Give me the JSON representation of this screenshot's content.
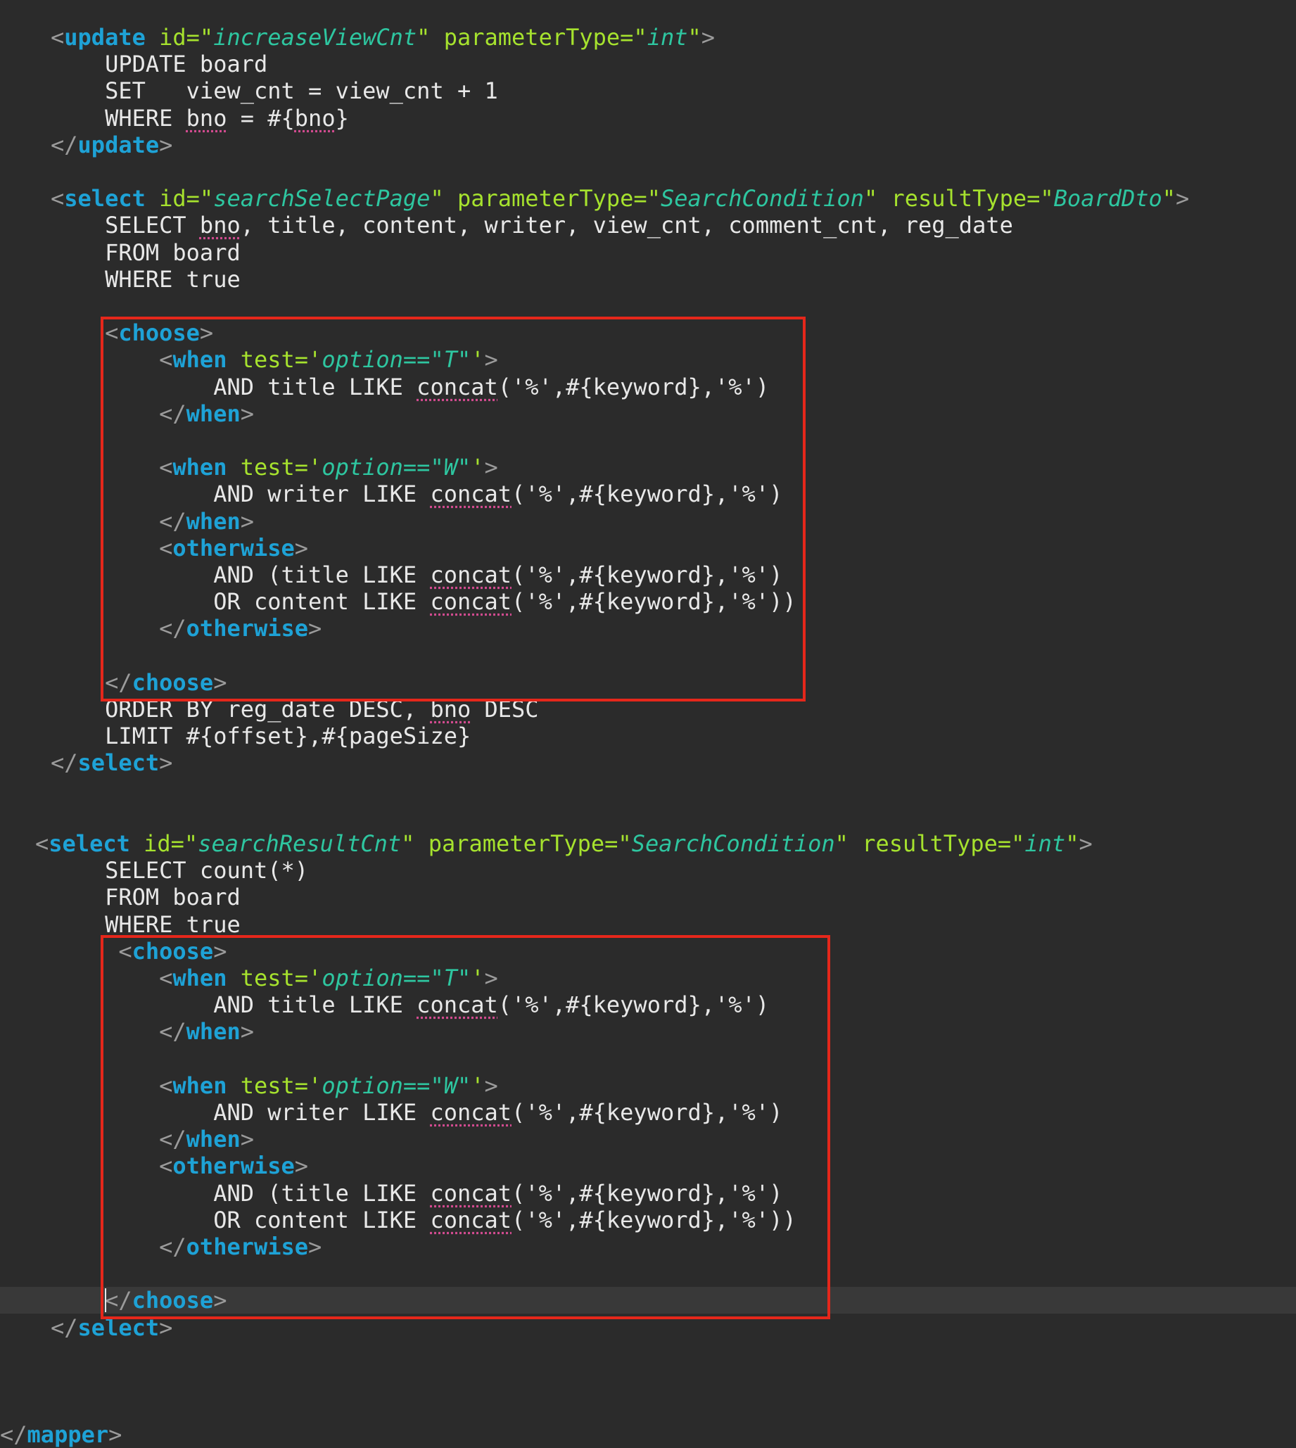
{
  "editor": {
    "lines": [
      [
        {
          "c": "punct",
          "t": "<"
        },
        {
          "c": "tag",
          "t": "update"
        },
        {
          "c": "sql",
          "t": " "
        },
        {
          "c": "attr",
          "t": "id="
        },
        {
          "c": "attr",
          "t": "\""
        },
        {
          "c": "str",
          "t": "increaseViewCnt"
        },
        {
          "c": "attr",
          "t": "\""
        },
        {
          "c": "sql",
          "t": " "
        },
        {
          "c": "attr",
          "t": "parameterType=\""
        },
        {
          "c": "str",
          "t": "int"
        },
        {
          "c": "attr",
          "t": "\""
        },
        {
          "c": "punct",
          "t": ">"
        }
      ],
      [
        {
          "c": "sql",
          "t": "    UPDATE board"
        }
      ],
      [
        {
          "c": "sql",
          "t": "    SET   view_cnt = view_cnt + 1"
        }
      ],
      [
        {
          "c": "sql",
          "t": "    WHERE "
        },
        {
          "c": "warn",
          "t": "bno"
        },
        {
          "c": "sql",
          "t": " = #{"
        },
        {
          "c": "warn",
          "t": "bno"
        },
        {
          "c": "sql",
          "t": "}"
        }
      ],
      [
        {
          "c": "punct",
          "t": "</"
        },
        {
          "c": "tag",
          "t": "update"
        },
        {
          "c": "punct",
          "t": ">"
        }
      ],
      [],
      [
        {
          "c": "punct",
          "t": "<"
        },
        {
          "c": "tag",
          "t": "select"
        },
        {
          "c": "sql",
          "t": " "
        },
        {
          "c": "attr",
          "t": "id=\""
        },
        {
          "c": "str",
          "t": "searchSelectPage"
        },
        {
          "c": "attr",
          "t": "\""
        },
        {
          "c": "sql",
          "t": " "
        },
        {
          "c": "attr",
          "t": "parameterType=\""
        },
        {
          "c": "str",
          "t": "SearchCondition"
        },
        {
          "c": "attr",
          "t": "\""
        },
        {
          "c": "sql",
          "t": " "
        },
        {
          "c": "attr",
          "t": "resultType=\""
        },
        {
          "c": "str",
          "t": "BoardDto"
        },
        {
          "c": "attr",
          "t": "\""
        },
        {
          "c": "punct",
          "t": ">"
        }
      ],
      [
        {
          "c": "sql",
          "t": "    SELECT "
        },
        {
          "c": "warn",
          "t": "bno"
        },
        {
          "c": "sql",
          "t": ", title, content, writer, view_cnt, comment_cnt, reg_date"
        }
      ],
      [
        {
          "c": "sql",
          "t": "    FROM board"
        }
      ],
      [
        {
          "c": "sql",
          "t": "    WHERE true"
        }
      ],
      [],
      [
        {
          "c": "sql",
          "t": "    "
        },
        {
          "c": "punct",
          "t": "<"
        },
        {
          "c": "tag",
          "t": "choose"
        },
        {
          "c": "punct",
          "t": ">"
        }
      ],
      [
        {
          "c": "sql",
          "t": "        "
        },
        {
          "c": "punct",
          "t": "<"
        },
        {
          "c": "tag",
          "t": "when"
        },
        {
          "c": "sql",
          "t": " "
        },
        {
          "c": "attr",
          "t": "test='"
        },
        {
          "c": "str",
          "t": "option==\"T\""
        },
        {
          "c": "attr",
          "t": "'"
        },
        {
          "c": "punct",
          "t": ">"
        }
      ],
      [
        {
          "c": "sql",
          "t": "            AND title LIKE "
        },
        {
          "c": "warn",
          "t": "concat"
        },
        {
          "c": "sql",
          "t": "('%',#{keyword},'%')"
        }
      ],
      [
        {
          "c": "sql",
          "t": "        "
        },
        {
          "c": "punct",
          "t": "</"
        },
        {
          "c": "tag",
          "t": "when"
        },
        {
          "c": "punct",
          "t": ">"
        }
      ],
      [],
      [
        {
          "c": "sql",
          "t": "        "
        },
        {
          "c": "punct",
          "t": "<"
        },
        {
          "c": "tag",
          "t": "when"
        },
        {
          "c": "sql",
          "t": " "
        },
        {
          "c": "attr",
          "t": "test='"
        },
        {
          "c": "str",
          "t": "option==\"W\""
        },
        {
          "c": "attr",
          "t": "'"
        },
        {
          "c": "punct",
          "t": ">"
        }
      ],
      [
        {
          "c": "sql",
          "t": "            AND writer LIKE "
        },
        {
          "c": "warn",
          "t": "concat"
        },
        {
          "c": "sql",
          "t": "('%',#{keyword},'%')"
        }
      ],
      [
        {
          "c": "sql",
          "t": "        "
        },
        {
          "c": "punct",
          "t": "</"
        },
        {
          "c": "tag",
          "t": "when"
        },
        {
          "c": "punct",
          "t": ">"
        }
      ],
      [
        {
          "c": "sql",
          "t": "        "
        },
        {
          "c": "punct",
          "t": "<"
        },
        {
          "c": "tag",
          "t": "otherwise"
        },
        {
          "c": "punct",
          "t": ">"
        }
      ],
      [
        {
          "c": "sql",
          "t": "            AND (title LIKE "
        },
        {
          "c": "warn",
          "t": "concat"
        },
        {
          "c": "sql",
          "t": "('%',#{keyword},'%')"
        }
      ],
      [
        {
          "c": "sql",
          "t": "            OR content LIKE "
        },
        {
          "c": "warn",
          "t": "concat"
        },
        {
          "c": "sql",
          "t": "('%',#{keyword},'%'))"
        }
      ],
      [
        {
          "c": "sql",
          "t": "        "
        },
        {
          "c": "punct",
          "t": "</"
        },
        {
          "c": "tag",
          "t": "otherwise"
        },
        {
          "c": "punct",
          "t": ">"
        }
      ],
      [],
      [
        {
          "c": "sql",
          "t": "    "
        },
        {
          "c": "punct",
          "t": "</"
        },
        {
          "c": "tag",
          "t": "choose"
        },
        {
          "c": "punct",
          "t": ">"
        }
      ],
      [
        {
          "c": "sql",
          "t": "    ORDER BY reg_date DESC, "
        },
        {
          "c": "warn",
          "t": "bno"
        },
        {
          "c": "sql",
          "t": " DESC"
        }
      ],
      [
        {
          "c": "sql",
          "t": "    LIMIT #{offset},#{pageSize}"
        }
      ],
      [
        {
          "c": "punct",
          "t": "</"
        },
        {
          "c": "tag",
          "t": "select"
        },
        {
          "c": "punct",
          "t": ">"
        }
      ],
      [],
      [],
      [
        {
          "c": "punct",
          "t": "<"
        },
        {
          "c": "tag",
          "t": "select"
        },
        {
          "c": "sql",
          "t": " "
        },
        {
          "c": "attr",
          "t": "id=\""
        },
        {
          "c": "str",
          "t": "searchResultCnt"
        },
        {
          "c": "attr",
          "t": "\""
        },
        {
          "c": "sql",
          "t": " "
        },
        {
          "c": "attr",
          "t": "parameterType=\""
        },
        {
          "c": "str",
          "t": "SearchCondition"
        },
        {
          "c": "attr",
          "t": "\""
        },
        {
          "c": "sql",
          "t": " "
        },
        {
          "c": "attr",
          "t": "resultType=\""
        },
        {
          "c": "str",
          "t": "int"
        },
        {
          "c": "attr",
          "t": "\""
        },
        {
          "c": "punct",
          "t": ">"
        }
      ],
      [
        {
          "c": "sql",
          "t": "    SELECT count(*)"
        }
      ],
      [
        {
          "c": "sql",
          "t": "    FROM board"
        }
      ],
      [
        {
          "c": "sql",
          "t": "    WHERE true"
        }
      ],
      [
        {
          "c": "sql",
          "t": "     "
        },
        {
          "c": "punct",
          "t": "<"
        },
        {
          "c": "tag",
          "t": "choose"
        },
        {
          "c": "punct",
          "t": ">"
        }
      ],
      [
        {
          "c": "sql",
          "t": "        "
        },
        {
          "c": "punct",
          "t": "<"
        },
        {
          "c": "tag",
          "t": "when"
        },
        {
          "c": "sql",
          "t": " "
        },
        {
          "c": "attr",
          "t": "test='"
        },
        {
          "c": "str",
          "t": "option==\"T\""
        },
        {
          "c": "attr",
          "t": "'"
        },
        {
          "c": "punct",
          "t": ">"
        }
      ],
      [
        {
          "c": "sql",
          "t": "            AND title LIKE "
        },
        {
          "c": "warn",
          "t": "concat"
        },
        {
          "c": "sql",
          "t": "('%',#{keyword},'%')"
        }
      ],
      [
        {
          "c": "sql",
          "t": "        "
        },
        {
          "c": "punct",
          "t": "</"
        },
        {
          "c": "tag",
          "t": "when"
        },
        {
          "c": "punct",
          "t": ">"
        }
      ],
      [],
      [
        {
          "c": "sql",
          "t": "        "
        },
        {
          "c": "punct",
          "t": "<"
        },
        {
          "c": "tag",
          "t": "when"
        },
        {
          "c": "sql",
          "t": " "
        },
        {
          "c": "attr",
          "t": "test='"
        },
        {
          "c": "str",
          "t": "option==\"W\""
        },
        {
          "c": "attr",
          "t": "'"
        },
        {
          "c": "punct",
          "t": ">"
        }
      ],
      [
        {
          "c": "sql",
          "t": "            AND writer LIKE "
        },
        {
          "c": "warn",
          "t": "concat"
        },
        {
          "c": "sql",
          "t": "('%',#{keyword},'%')"
        }
      ],
      [
        {
          "c": "sql",
          "t": "        "
        },
        {
          "c": "punct",
          "t": "</"
        },
        {
          "c": "tag",
          "t": "when"
        },
        {
          "c": "punct",
          "t": ">"
        }
      ],
      [
        {
          "c": "sql",
          "t": "        "
        },
        {
          "c": "punct",
          "t": "<"
        },
        {
          "c": "tag",
          "t": "otherwise"
        },
        {
          "c": "punct",
          "t": ">"
        }
      ],
      [
        {
          "c": "sql",
          "t": "            AND (title LIKE "
        },
        {
          "c": "warn",
          "t": "concat"
        },
        {
          "c": "sql",
          "t": "('%',#{keyword},'%')"
        }
      ],
      [
        {
          "c": "sql",
          "t": "            OR content LIKE "
        },
        {
          "c": "warn",
          "t": "concat"
        },
        {
          "c": "sql",
          "t": "('%',#{keyword},'%'))"
        }
      ],
      [
        {
          "c": "sql",
          "t": "        "
        },
        {
          "c": "punct",
          "t": "</"
        },
        {
          "c": "tag",
          "t": "otherwise"
        },
        {
          "c": "punct",
          "t": ">"
        }
      ],
      [],
      [
        {
          "c": "sql",
          "t": "    "
        },
        {
          "c": "punct",
          "t": "</"
        },
        {
          "c": "tag",
          "t": "choose"
        },
        {
          "c": "punct",
          "t": ">"
        }
      ],
      [
        {
          "c": "punct",
          "t": "</"
        },
        {
          "c": "tag",
          "t": "select"
        },
        {
          "c": "punct",
          "t": ">"
        }
      ],
      [],
      [],
      [],
      [
        {
          "c": "punct",
          "t": "</"
        },
        {
          "c": "tag",
          "t": "mapper"
        },
        {
          "c": "punct",
          "t": ">"
        }
      ]
    ],
    "current_line_index": 47,
    "highlight_boxes": [
      {
        "from_line": 11,
        "to_line": 24
      },
      {
        "from_line": 34,
        "to_line": 47
      }
    ]
  },
  "colors": {
    "background": "#2b2b2b",
    "tag": "#1ea2d6",
    "attribute": "#a6e22e",
    "string": "#2ec6a0",
    "text": "#e8e8e8",
    "punctuation": "#9b9b9b",
    "highlight_box": "#e5271b",
    "spell_underline": "#d14b8f"
  }
}
